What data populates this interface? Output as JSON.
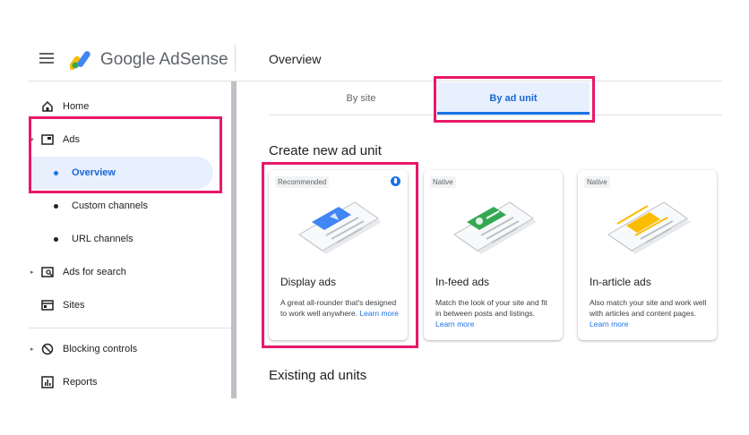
{
  "app": {
    "brand": "Google AdSense"
  },
  "header": {
    "title": "Overview"
  },
  "sidebar": {
    "items": [
      {
        "label": "Home"
      },
      {
        "label": "Ads"
      },
      {
        "label": "Overview"
      },
      {
        "label": "Custom channels"
      },
      {
        "label": "URL channels"
      },
      {
        "label": "Ads for search"
      },
      {
        "label": "Sites"
      },
      {
        "label": "Blocking controls"
      },
      {
        "label": "Reports"
      }
    ]
  },
  "tabs": [
    {
      "label": "By site"
    },
    {
      "label": "By ad unit"
    }
  ],
  "create": {
    "title": "Create new ad unit",
    "cards": [
      {
        "badge": "Recommended",
        "title": "Display ads",
        "desc": "A great all-rounder that's designed to work well anywhere.",
        "link": "Learn more",
        "accent": "#4285f4"
      },
      {
        "badge": "Native",
        "title": "In-feed ads",
        "desc": "Match the look of your site and fit in between posts and listings.",
        "link": "Learn more",
        "accent": "#34a853"
      },
      {
        "badge": "Native",
        "title": "In-article ads",
        "desc": "Also match your site and work well with articles and content pages.",
        "link": "Learn more",
        "accent": "#fbbc04"
      }
    ]
  },
  "existing": {
    "title": "Existing ad units"
  },
  "colors": {
    "highlight": "#e8186a",
    "accent": "#1a73e8",
    "active_bg": "#e8f0fe"
  },
  "icons": [
    "menu-icon",
    "adsense-logo",
    "home-icon",
    "ads-icon",
    "ads-for-search-icon",
    "sites-icon",
    "blocking-controls-icon",
    "reports-icon",
    "recommended-icon"
  ]
}
